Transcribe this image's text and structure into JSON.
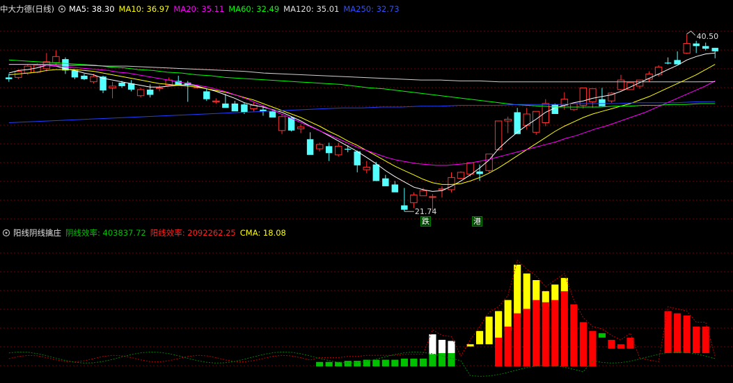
{
  "main_panel": {
    "stock_title": "中大力德(日线)",
    "ma_labels": [
      {
        "text": "MA5: 38.30",
        "color": "#ffffff"
      },
      {
        "text": "MA10: 36.97",
        "color": "#ffff00"
      },
      {
        "text": "MA20: 35.11",
        "color": "#ff00ff"
      },
      {
        "text": "MA60: 32.49",
        "color": "#00ff00"
      },
      {
        "text": "MA120: 35.01",
        "color": "#e0e0e0"
      },
      {
        "text": "MA250: 32.73",
        "color": "#3050ff"
      }
    ],
    "high_label": "40.50",
    "low_label": "21.74",
    "tag_left": "跌",
    "tag_right": "港",
    "colors": {
      "up": "#ff3232",
      "down": "#54ffff",
      "grid": "#7a0000"
    }
  },
  "sub_panel": {
    "indicator_title": "阳线阴线擒庄",
    "labels": [
      {
        "text": "阴线效率: 403837.72",
        "color": "#00c000"
      },
      {
        "text": "阳线效率: 2092262.25",
        "color": "#ff2020"
      },
      {
        "text": "CMA: 18.08",
        "color": "#ffff00"
      }
    ]
  },
  "chart_data": [
    {
      "type": "candlestick",
      "title": "中大力德(日线)",
      "candles": [
        [
          35.5,
          35.9,
          35.0,
          35.3
        ],
        [
          35.5,
          36.4,
          35.3,
          36.2
        ],
        [
          36.0,
          37.0,
          35.8,
          36.8
        ],
        [
          36.1,
          37.1,
          36.0,
          36.9
        ],
        [
          36.5,
          38.3,
          36.2,
          37.3
        ],
        [
          37.2,
          38.6,
          36.9,
          37.9
        ],
        [
          37.6,
          37.8,
          35.9,
          36.3
        ],
        [
          36.3,
          36.4,
          35.3,
          35.5
        ],
        [
          35.7,
          35.9,
          35.2,
          35.3
        ],
        [
          35.0,
          35.9,
          34.8,
          35.6
        ],
        [
          35.6,
          35.7,
          33.7,
          34.0
        ],
        [
          34.3,
          35.0,
          33.1,
          34.5
        ],
        [
          34.9,
          35.1,
          34.3,
          34.5
        ],
        [
          34.8,
          35.2,
          33.9,
          34.1
        ],
        [
          33.4,
          34.3,
          33.2,
          34.1
        ],
        [
          34.1,
          34.7,
          33.2,
          33.5
        ],
        [
          34.2,
          34.6,
          33.9,
          34.3
        ],
        [
          34.6,
          35.5,
          34.5,
          35.2
        ],
        [
          35.1,
          35.7,
          34.8,
          34.6
        ],
        [
          34.9,
          35.1,
          32.7,
          34.6
        ],
        [
          34.4,
          34.5,
          34.2,
          34.4
        ],
        [
          33.9,
          34.2,
          32.8,
          33.0
        ],
        [
          32.7,
          33.1,
          32.5,
          32.8
        ],
        [
          32.5,
          33.6,
          32.4,
          32.0
        ],
        [
          32.5,
          32.8,
          31.8,
          31.6
        ],
        [
          32.4,
          32.6,
          31.3,
          31.5
        ],
        [
          31.9,
          32.6,
          31.6,
          32.3
        ],
        [
          31.8,
          32.3,
          31.1,
          31.6
        ],
        [
          31.6,
          31.8,
          31.0,
          30.9
        ],
        [
          29.4,
          31.2,
          29.0,
          31.0
        ],
        [
          30.9,
          31.0,
          29.3,
          29.4
        ],
        [
          29.6,
          30.1,
          29.1,
          29.8
        ],
        [
          28.4,
          29.2,
          27.0,
          26.6
        ],
        [
          27.3,
          28.0,
          27.0,
          27.8
        ],
        [
          27.6,
          28.0,
          25.9,
          26.8
        ],
        [
          26.6,
          28.0,
          26.4,
          27.6
        ],
        [
          27.3,
          27.7,
          26.9,
          27.2
        ],
        [
          27.0,
          27.1,
          24.6,
          25.4
        ],
        [
          24.9,
          25.9,
          24.5,
          25.2
        ],
        [
          25.5,
          25.8,
          23.7,
          23.6
        ],
        [
          23.9,
          24.3,
          23.5,
          23.0
        ],
        [
          23.2,
          23.6,
          22.7,
          22.3
        ],
        [
          20.8,
          22.8,
          20.1,
          20.3
        ],
        [
          21.1,
          22.3,
          20.5,
          22.0
        ],
        [
          21.9,
          22.8,
          21.9,
          22.5
        ],
        [
          21.8,
          22.1,
          20.2,
          21.8
        ],
        [
          22.6,
          23.0,
          21.7,
          22.7
        ],
        [
          22.6,
          24.6,
          22.3,
          24.0
        ],
        [
          23.9,
          24.7,
          23.8,
          24.6
        ],
        [
          24.4,
          25.0,
          24.1,
          25.7
        ],
        [
          24.7,
          25.5,
          23.6,
          24.4
        ],
        [
          24.8,
          26.7,
          24.6,
          26.7
        ],
        [
          27.2,
          30.1,
          27.1,
          30.5
        ],
        [
          30.5,
          31.0,
          29.1,
          30.7
        ],
        [
          31.5,
          32.0,
          29.8,
          29.0
        ],
        [
          30.0,
          32.0,
          29.5,
          31.3
        ],
        [
          29.2,
          31.6,
          28.9,
          31.6
        ],
        [
          30.3,
          33.0,
          29.9,
          32.5
        ],
        [
          32.4,
          32.5,
          31.8,
          31.3
        ],
        [
          32.3,
          33.8,
          31.8,
          33.0
        ],
        [
          31.8,
          32.3,
          31.7,
          32.5
        ],
        [
          32.3,
          33.3,
          31.9,
          34.3
        ],
        [
          32.7,
          33.2,
          32.0,
          34.2
        ],
        [
          33.0,
          34.3,
          32.6,
          32.2
        ],
        [
          32.8,
          33.8,
          32.6,
          33.7
        ],
        [
          34.1,
          35.8,
          34.0,
          35.2
        ],
        [
          34.1,
          34.6,
          34.1,
          34.9
        ],
        [
          34.5,
          35.0,
          34.2,
          35.2
        ],
        [
          35.3,
          36.2,
          35.0,
          35.9
        ],
        [
          35.8,
          36.9,
          35.6,
          36.7
        ],
        [
          37.2,
          37.8,
          37.0,
          37.1
        ],
        [
          37.5,
          38.5,
          37.1,
          37.0
        ],
        [
          38.3,
          40.5,
          38.2,
          39.4
        ],
        [
          39.4,
          39.7,
          38.3,
          39.1
        ],
        [
          39.1,
          39.5,
          38.6,
          38.8
        ],
        [
          38.9,
          38.9,
          37.7,
          38.5
        ]
      ],
      "ma": {
        "MA5": [
          36.0,
          36.3,
          36.4,
          36.6,
          36.9,
          36.8,
          36.5,
          36.3,
          36.0,
          35.8,
          35.4,
          35.2,
          35.0,
          34.8,
          34.6,
          34.4,
          34.4,
          34.5,
          34.6,
          34.7,
          34.5,
          34.2,
          33.9,
          33.5,
          33.1,
          32.6,
          32.3,
          32.1,
          31.8,
          31.5,
          31.0,
          30.5,
          29.9,
          29.4,
          28.8,
          28.2,
          27.6,
          27.0,
          26.3,
          25.6,
          24.8,
          24.1,
          23.5,
          22.9,
          22.6,
          22.4,
          22.5,
          23.0,
          23.6,
          24.3,
          25.1,
          26.0,
          27.3,
          28.3,
          29.2,
          30.0,
          30.7,
          31.5,
          32.0,
          32.3,
          32.6,
          32.8,
          33.1,
          33.3,
          33.5,
          33.9,
          34.4,
          34.9,
          35.4,
          35.9,
          36.4,
          36.9,
          37.5,
          37.9,
          38.2,
          38.3
        ],
        "MA10": [
          35.8,
          35.9,
          36.0,
          36.1,
          36.3,
          36.4,
          36.4,
          36.4,
          36.3,
          36.2,
          36.0,
          35.8,
          35.6,
          35.4,
          35.2,
          35.0,
          34.8,
          34.7,
          34.6,
          34.5,
          34.4,
          34.2,
          34.0,
          33.8,
          33.5,
          33.2,
          32.9,
          32.5,
          32.1,
          31.7,
          31.3,
          30.9,
          30.4,
          29.9,
          29.3,
          28.8,
          28.2,
          27.7,
          27.1,
          26.5,
          25.9,
          25.3,
          24.8,
          24.3,
          23.8,
          23.4,
          23.2,
          23.2,
          23.3,
          23.6,
          24.0,
          24.5,
          25.1,
          25.8,
          26.5,
          27.2,
          27.9,
          28.6,
          29.3,
          29.9,
          30.4,
          30.9,
          31.3,
          31.6,
          31.9,
          32.2,
          32.5,
          32.9,
          33.3,
          33.8,
          34.3,
          34.8,
          35.3,
          35.8,
          36.4,
          37.0
        ],
        "MA20": [
          37.0,
          37.0,
          37.0,
          36.9,
          36.9,
          36.8,
          36.7,
          36.6,
          36.5,
          36.4,
          36.3,
          36.1,
          36.0,
          35.8,
          35.6,
          35.4,
          35.2,
          35.0,
          34.8,
          34.6,
          34.4,
          34.1,
          33.8,
          33.4,
          33.0,
          32.5,
          32.0,
          31.5,
          31.0,
          30.5,
          30.0,
          29.5,
          29.0,
          28.5,
          28.0,
          27.5,
          27.1,
          26.7,
          26.3,
          26.0,
          25.8,
          25.6,
          25.5,
          25.4,
          25.4,
          25.5,
          25.6,
          25.8,
          26.0,
          26.3,
          26.6,
          26.9,
          27.2,
          27.5,
          27.8,
          28.1,
          28.5,
          28.8,
          29.2,
          29.6,
          29.9,
          30.3,
          30.7,
          31.1,
          31.5,
          32.0,
          32.5,
          33.0,
          33.5,
          34.0,
          34.5,
          35.1
        ],
        "MA60": [
          37.5,
          37.4,
          37.3,
          37.2,
          37.1,
          37.0,
          36.9,
          36.7,
          36.6,
          36.4,
          36.3,
          36.1,
          36.0,
          35.8,
          35.7,
          35.5,
          35.4,
          35.3,
          35.2,
          35.1,
          35.0,
          34.9,
          34.8,
          34.7,
          34.5,
          34.3,
          34.2,
          34.0,
          33.8,
          33.6,
          33.4,
          33.2,
          33.0,
          32.8,
          32.6,
          32.4,
          32.3,
          32.2,
          32.1,
          32.1,
          32.1,
          32.1,
          32.2,
          32.2,
          32.3,
          32.3,
          32.4,
          32.4,
          32.5,
          32.5
        ],
        "MA120": [
          37.0,
          37.0,
          37.0,
          36.9,
          36.9,
          36.8,
          36.8,
          36.7,
          36.6,
          36.5,
          36.4,
          36.3,
          36.2,
          36.0,
          35.9,
          35.8,
          35.7,
          35.6,
          35.5,
          35.4,
          35.3,
          35.2,
          35.2,
          35.1,
          35.1,
          35.0,
          35.0,
          35.0,
          35.0,
          35.0,
          35.0,
          35.0,
          35.0,
          35.0,
          35.0,
          35.0,
          35.01
        ],
        "MA250": [
          30.3,
          30.4,
          30.5,
          30.6,
          30.7,
          30.8,
          30.9,
          31.0,
          31.1,
          31.2,
          31.3,
          31.4,
          31.5,
          31.6,
          31.7,
          31.8,
          31.9,
          32.0,
          32.0,
          32.1,
          32.1,
          32.2,
          32.2,
          32.3,
          32.3,
          32.3,
          32.4,
          32.4,
          32.4,
          32.5,
          32.5,
          32.5,
          32.6,
          32.6,
          32.6,
          32.7,
          32.73
        ]
      },
      "ylim": [
        19.0,
        42.0
      ]
    },
    {
      "type": "bar",
      "title": "阳线阴线擒庄",
      "bars": [
        {
          "i": 33,
          "lo": 0.2,
          "hi": 0.0,
          "color": "#00c000"
        },
        {
          "i": 34,
          "lo": 0.2,
          "hi": 0.0,
          "color": "#00c000"
        },
        {
          "i": 35,
          "lo": 0.2,
          "hi": 0.0,
          "color": "#00c000"
        },
        {
          "i": 36,
          "lo": 0.25,
          "hi": 0.0,
          "color": "#00c000"
        },
        {
          "i": 37,
          "lo": 0.25,
          "hi": 0.0,
          "color": "#00c000"
        },
        {
          "i": 38,
          "lo": 0.3,
          "hi": 0.0,
          "color": "#00c000"
        },
        {
          "i": 39,
          "lo": 0.3,
          "hi": 0.0,
          "color": "#00c000"
        },
        {
          "i": 40,
          "lo": 0.3,
          "hi": 0.0,
          "color": "#00c000"
        },
        {
          "i": 41,
          "lo": 0.3,
          "hi": 0.0,
          "color": "#00c000"
        },
        {
          "i": 42,
          "lo": 0.35,
          "hi": 0.0,
          "color": "#00c000"
        },
        {
          "i": 43,
          "lo": 0.35,
          "hi": 0.0,
          "color": "#00c000"
        },
        {
          "i": 44,
          "lo": 0.35,
          "hi": 0.0,
          "color": "#00c000"
        },
        {
          "i": 45,
          "lo": 0.55,
          "hi": 0.0,
          "color": "#00c000"
        },
        {
          "i": 46,
          "lo": 0.6,
          "hi": 0.0,
          "color": "#00c000"
        },
        {
          "i": 47,
          "lo": 0.6,
          "hi": 0.0,
          "color": "#00c000"
        },
        {
          "i": 45,
          "lo": 1.45,
          "hi": 0.55,
          "color": "#ffffff"
        },
        {
          "i": 46,
          "lo": 1.2,
          "hi": 0.6,
          "color": "#ffffff"
        },
        {
          "i": 47,
          "lo": 1.15,
          "hi": 0.6,
          "color": "#ffffff"
        },
        {
          "i": 49,
          "lo": 1.0,
          "hi": 0.9,
          "color": "#ffff00"
        },
        {
          "i": 50,
          "lo": 1.6,
          "hi": 1.0,
          "color": "#ffff00"
        },
        {
          "i": 51,
          "lo": 2.25,
          "hi": 1.0,
          "color": "#ffff00"
        },
        {
          "i": 52,
          "lo": 2.5,
          "hi": 1.1,
          "color": "#ffff00"
        },
        {
          "i": 53,
          "lo": 3.0,
          "hi": 1.6,
          "color": "#ffff00"
        },
        {
          "i": 54,
          "lo": 4.6,
          "hi": 2.2,
          "color": "#ffff00"
        },
        {
          "i": 55,
          "lo": 4.2,
          "hi": 2.5,
          "color": "#ffff00"
        },
        {
          "i": 56,
          "lo": 3.9,
          "hi": 2.9,
          "color": "#ffff00"
        },
        {
          "i": 57,
          "lo": 3.4,
          "hi": 2.7,
          "color": "#ffff00"
        },
        {
          "i": 58,
          "lo": 3.7,
          "hi": 2.9,
          "color": "#ffff00"
        },
        {
          "i": 59,
          "lo": 4.0,
          "hi": 3.3,
          "color": "#ffff00"
        },
        {
          "i": 52,
          "lo": 1.3,
          "hi": 0.0,
          "color": "#ff0000"
        },
        {
          "i": 53,
          "lo": 1.8,
          "hi": 0.0,
          "color": "#ff0000"
        },
        {
          "i": 54,
          "lo": 2.4,
          "hi": 0.0,
          "color": "#ff0000"
        },
        {
          "i": 55,
          "lo": 2.6,
          "hi": 0.0,
          "color": "#ff0000"
        },
        {
          "i": 56,
          "lo": 3.0,
          "hi": 0.0,
          "color": "#ff0000"
        },
        {
          "i": 57,
          "lo": 2.9,
          "hi": 0.0,
          "color": "#ff0000"
        },
        {
          "i": 58,
          "lo": 3.0,
          "hi": 0.0,
          "color": "#ff0000"
        },
        {
          "i": 59,
          "lo": 3.4,
          "hi": 0.0,
          "color": "#ff0000"
        },
        {
          "i": 60,
          "lo": 2.8,
          "hi": 0.0,
          "color": "#ff0000"
        },
        {
          "i": 61,
          "lo": 2.0,
          "hi": 0.0,
          "color": "#ff0000"
        },
        {
          "i": 62,
          "lo": 1.6,
          "hi": 0.0,
          "color": "#ff0000"
        },
        {
          "i": 63,
          "lo": 1.5,
          "hi": 1.3,
          "color": "#00c000"
        },
        {
          "i": 64,
          "lo": 1.2,
          "hi": 0.8,
          "color": "#ff0000"
        },
        {
          "i": 65,
          "lo": 1.0,
          "hi": 0.8,
          "color": "#ff0000"
        },
        {
          "i": 66,
          "lo": 1.3,
          "hi": 0.8,
          "color": "#ff0000"
        },
        {
          "i": 70,
          "lo": 2.5,
          "hi": 0.6,
          "color": "#ff0000"
        },
        {
          "i": 71,
          "lo": 2.4,
          "hi": 0.6,
          "color": "#ff0000"
        },
        {
          "i": 72,
          "lo": 2.3,
          "hi": 0.6,
          "color": "#ff0000"
        },
        {
          "i": 73,
          "lo": 1.8,
          "hi": 0.6,
          "color": "#ff0000"
        },
        {
          "i": 74,
          "lo": 1.8,
          "hi": 0.6,
          "color": "#ff0000"
        }
      ],
      "ylim": [
        -0.5,
        5.0
      ]
    }
  ]
}
